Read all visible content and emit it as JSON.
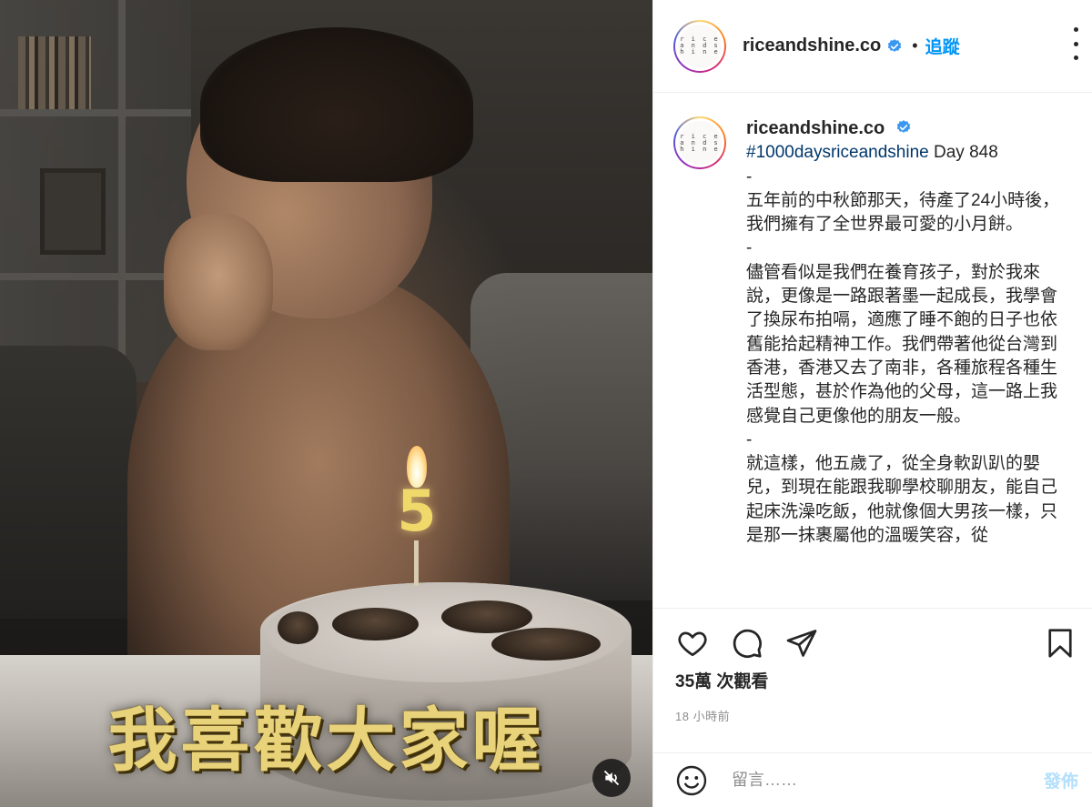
{
  "media": {
    "caption_overlay": "我喜歡大家喔",
    "candle_number": "5",
    "mute_icon": "speaker-muted-icon"
  },
  "header": {
    "avatar_text": [
      "r i c e",
      "a n d s",
      "h i n e"
    ],
    "username": "riceandshine.co",
    "separator": "•",
    "follow_label": "追蹤",
    "verified_icon": "verified-badge-icon",
    "more_icon": "more-options-icon"
  },
  "caption": {
    "username": "riceandshine.co",
    "hashtag": "#1000daysriceandshine",
    "day_text": " Day 848",
    "lines": [
      "-",
      "五年前的中秋節那天，待產了24小時後，我們擁有了全世界最可愛的小月餅。",
      "-",
      "儘管看似是我們在養育孩子，對於我來說，更像是一路跟著墨一起成長，我學會了換尿布拍嗝，適應了睡不飽的日子也依舊能拾起精神工作。我們帶著他從台灣到香港，香港又去了南非，各種旅程各種生活型態，甚於作為他的父母，這一路上我感覺自己更像他的朋友一般。",
      "-",
      "就這樣，他五歲了，從全身軟趴趴的嬰兒，到現在能跟我聊學校聊朋友，能自己起床洗澡吃飯，他就像個大男孩一樣，只是那一抹裹屬他的溫暖笑容，從"
    ]
  },
  "actions": {
    "like_icon": "heart-icon",
    "comment_icon": "comment-icon",
    "share_icon": "share-icon",
    "save_icon": "bookmark-icon",
    "views": "35萬 次觀看",
    "time": "18 小時前"
  },
  "comment_box": {
    "emoji_icon": "emoji-icon",
    "placeholder": "留言……",
    "post_label": "發佈"
  },
  "colors": {
    "accent": "#0095f6",
    "caption_gold": "#e9d37a",
    "hashtag": "#00376b",
    "muted_text": "#8e8e8e"
  }
}
